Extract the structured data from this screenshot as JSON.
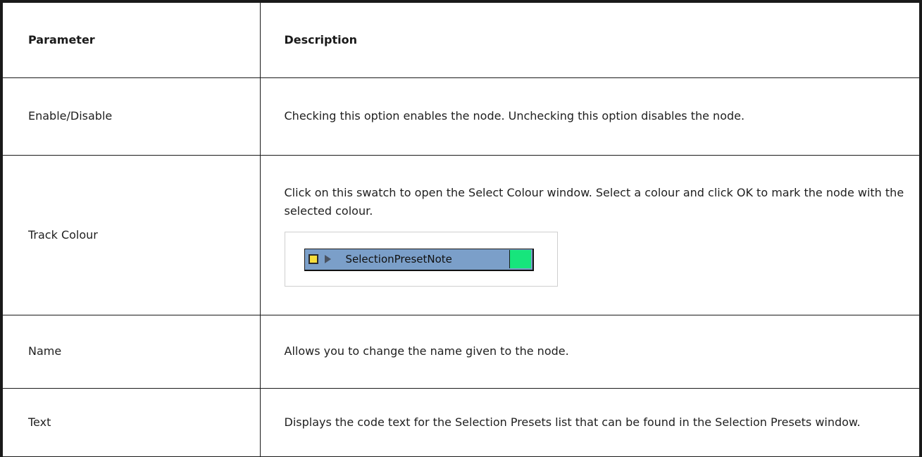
{
  "table": {
    "header": {
      "parameter": "Parameter",
      "description": "Description"
    },
    "rows": [
      {
        "parameter": "Enable/Disable",
        "description": "Checking this option enables the node. Unchecking this option disables the node."
      },
      {
        "parameter": "Track Colour",
        "description": "Click on this swatch to open the Select Colour window. Select a colour and click OK to mark the node with the selected colour.",
        "swatch": {
          "node_label": "SelectionPresetNote",
          "bar_color": "#7b9fc9",
          "enable_box_color": "#f6de3b",
          "track_color": "#17e57c",
          "icons": [
            "enable-checkbox-icon",
            "play-arrow-icon"
          ]
        }
      },
      {
        "parameter": "Name",
        "description": "Allows you to change the name given to the node."
      },
      {
        "parameter": "Text",
        "description": "Displays the code text for the Selection Presets list that can be found in the Selection Presets window."
      }
    ]
  }
}
